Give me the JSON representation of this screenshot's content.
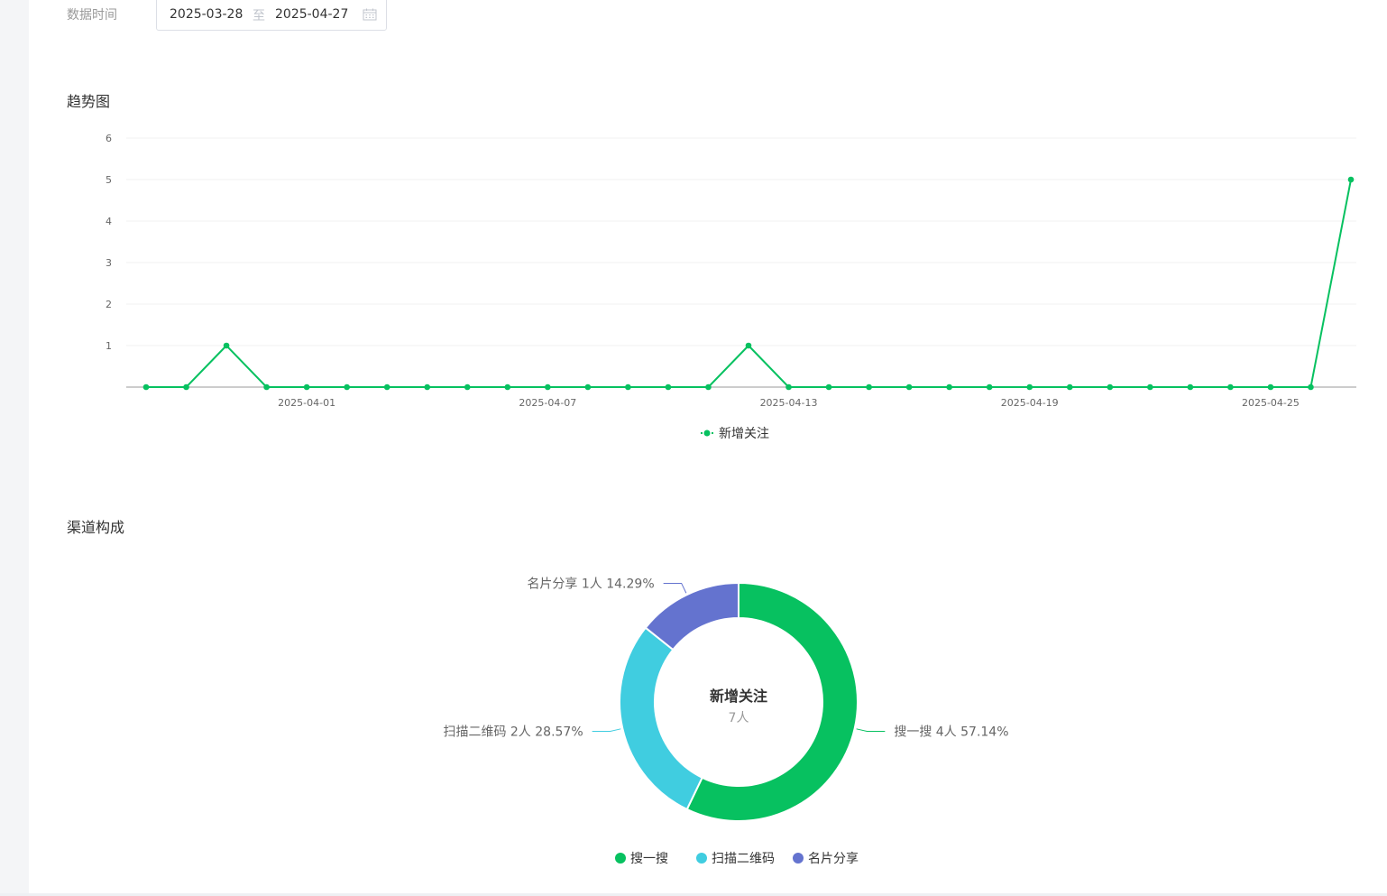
{
  "filter": {
    "label": "数据时间",
    "start_date": "2025-03-28",
    "separator": "至",
    "end_date": "2025-04-27"
  },
  "trend": {
    "title": "趋势图"
  },
  "channel": {
    "title": "渠道构成"
  },
  "colors": {
    "line": "#07c160",
    "slice_search": "#07c160",
    "slice_qr": "#40cde0",
    "slice_card": "#6473cf"
  },
  "chart_data": [
    {
      "type": "line",
      "title": "趋势图",
      "x": [
        "2025-03-28",
        "2025-03-29",
        "2025-03-30",
        "2025-03-31",
        "2025-04-01",
        "2025-04-02",
        "2025-04-03",
        "2025-04-04",
        "2025-04-05",
        "2025-04-06",
        "2025-04-07",
        "2025-04-08",
        "2025-04-09",
        "2025-04-10",
        "2025-04-11",
        "2025-04-12",
        "2025-04-13",
        "2025-04-14",
        "2025-04-15",
        "2025-04-16",
        "2025-04-17",
        "2025-04-18",
        "2025-04-19",
        "2025-04-20",
        "2025-04-21",
        "2025-04-22",
        "2025-04-23",
        "2025-04-24",
        "2025-04-25",
        "2025-04-26",
        "2025-04-27"
      ],
      "x_tick_labels": [
        "2025-04-01",
        "2025-04-07",
        "2025-04-13",
        "2025-04-19",
        "2025-04-25"
      ],
      "y_ticks": [
        "1",
        "2",
        "3",
        "4",
        "5",
        "6"
      ],
      "ylim": [
        0,
        6
      ],
      "grid": true,
      "legend_position": "bottom-center",
      "series": [
        {
          "name": "新增关注",
          "values": [
            0,
            0,
            1,
            0,
            0,
            0,
            0,
            0,
            0,
            0,
            0,
            0,
            0,
            0,
            0,
            1,
            0,
            0,
            0,
            0,
            0,
            0,
            0,
            0,
            0,
            0,
            0,
            0,
            0,
            0,
            5
          ]
        }
      ]
    },
    {
      "type": "pie",
      "title": "渠道构成",
      "center_title": "新增关注",
      "center_value": "7人",
      "legend_position": "bottom-center",
      "slices": [
        {
          "name": "搜一搜",
          "value": 4,
          "label": "搜一搜 4人 57.14%"
        },
        {
          "name": "扫描二维码",
          "value": 2,
          "label": "扫描二维码 2人 28.57%"
        },
        {
          "name": "名片分享",
          "value": 1,
          "label": "名片分享 1人 14.29%"
        }
      ]
    }
  ]
}
